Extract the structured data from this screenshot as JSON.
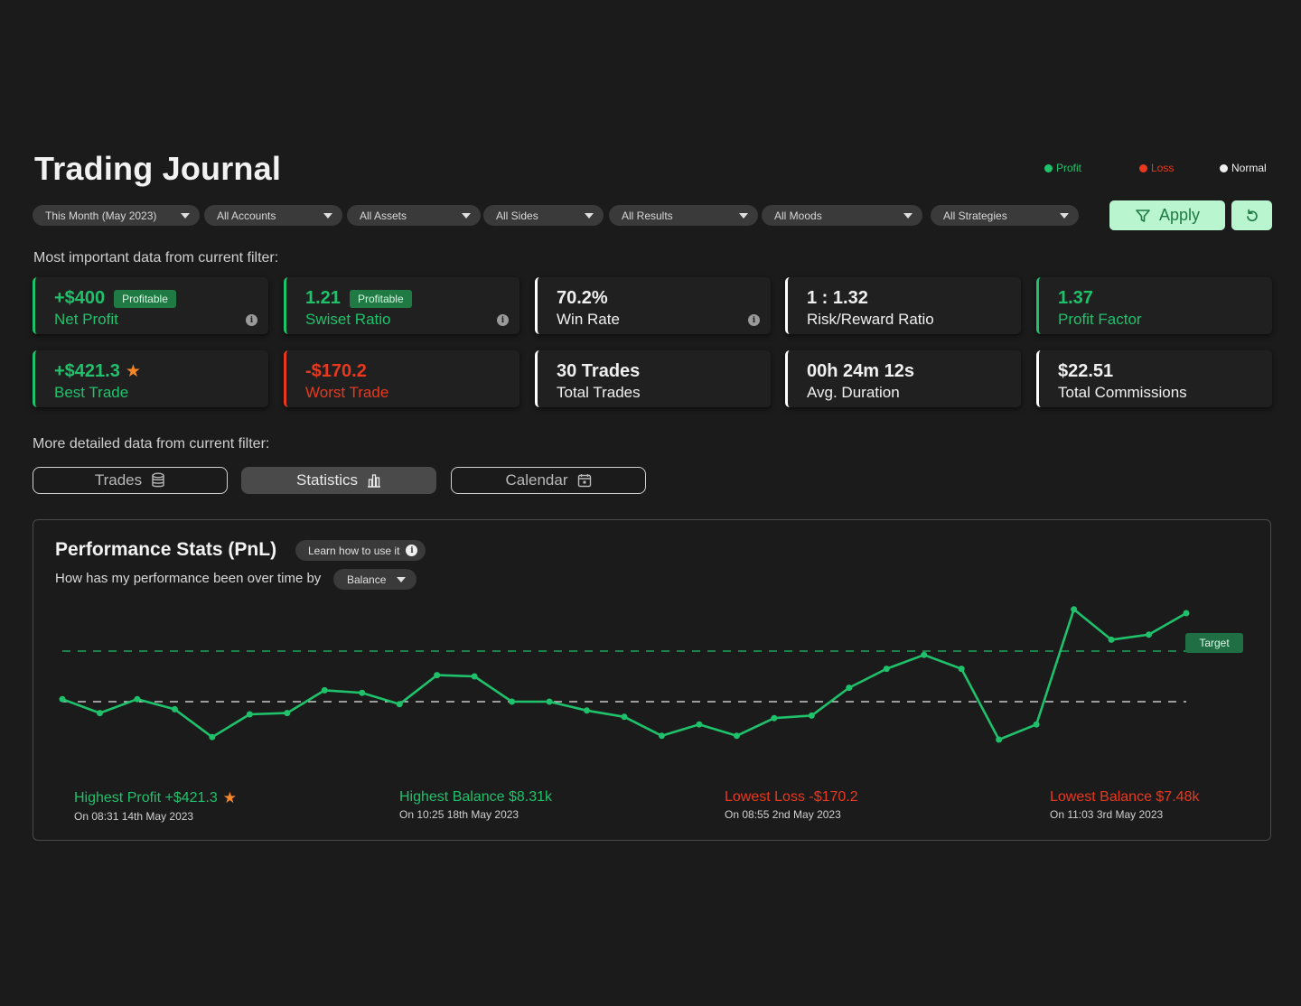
{
  "header": {
    "title": "Trading Journal"
  },
  "legend": {
    "profit": {
      "label": "Profit",
      "color": "#1fc16b"
    },
    "loss": {
      "label": "Loss",
      "color": "#e8391f"
    },
    "normal": {
      "label": "Normal",
      "color": "#f0f0f0"
    }
  },
  "filters": [
    "This Month (May 2023)",
    "All Accounts",
    "All Assets",
    "All Sides",
    "All Results",
    "All Moods",
    "All Strategies"
  ],
  "actions": {
    "apply_label": "Apply"
  },
  "summary": {
    "heading": "Most important data from current filter:",
    "cards": [
      {
        "value": "+$400",
        "label": "Net Profit",
        "badge": "Profitable"
      },
      {
        "value": "1.21",
        "label": "Swiset Ratio",
        "badge": "Profitable"
      },
      {
        "value": "70.2%",
        "label": "Win Rate"
      },
      {
        "value": "1 : 1.32",
        "label": "Risk/Reward Ratio"
      },
      {
        "value": "1.37",
        "label": "Profit Factor"
      },
      {
        "value": "+$421.3",
        "label": "Best Trade"
      },
      {
        "value": "-$170.2",
        "label": "Worst Trade"
      },
      {
        "value": "30 Trades",
        "label": "Total Trades"
      },
      {
        "value": "00h 24m 12s",
        "label": "Avg. Duration"
      },
      {
        "value": "$22.51",
        "label": "Total Commissions"
      }
    ]
  },
  "detail": {
    "heading": "More detailed data from current filter:",
    "tabs": [
      "Trades",
      "Statistics",
      "Calendar"
    ],
    "active_tab": "Statistics"
  },
  "performance": {
    "title": "Performance Stats (PnL)",
    "learn_label": "Learn how to use it",
    "subtitle": "How has my performance been over time by",
    "metric": "Balance",
    "target_label": "Target",
    "stats": [
      {
        "title": "Highest Profit +$421.3",
        "date": "On 08:31 14th May 2023"
      },
      {
        "title": "Highest Balance $8.31k",
        "date": "On 10:25 18th May 2023"
      },
      {
        "title": "Lowest Loss -$170.2",
        "date": "On 08:55 2nd May 2023"
      },
      {
        "title": "Lowest Balance $7.48k",
        "date": "On 11:03 3rd May 2023"
      }
    ]
  },
  "chart_data": {
    "type": "line",
    "x": [
      1,
      2,
      3,
      4,
      5,
      6,
      7,
      8,
      9,
      10,
      11,
      12,
      13,
      14,
      15,
      16,
      17,
      18,
      19,
      20,
      21,
      22,
      23,
      24,
      25,
      26,
      27,
      28,
      29,
      30,
      31
    ],
    "series": [
      {
        "values": [
          0.62,
          0.51,
          0.62,
          0.54,
          0.32,
          0.5,
          0.51,
          0.69,
          0.67,
          0.58,
          0.81,
          0.8,
          0.6,
          0.6,
          0.53,
          0.48,
          0.33,
          0.42,
          0.33,
          0.47,
          0.49,
          0.71,
          0.86,
          0.97,
          0.86,
          0.3,
          0.42,
          1.33,
          1.09,
          1.13,
          1.3
        ],
        "color": "#1fc16b"
      }
    ],
    "target_line": 1.0,
    "baseline": 0.6,
    "ylim": [
      0,
      1.5
    ],
    "grid": false
  }
}
